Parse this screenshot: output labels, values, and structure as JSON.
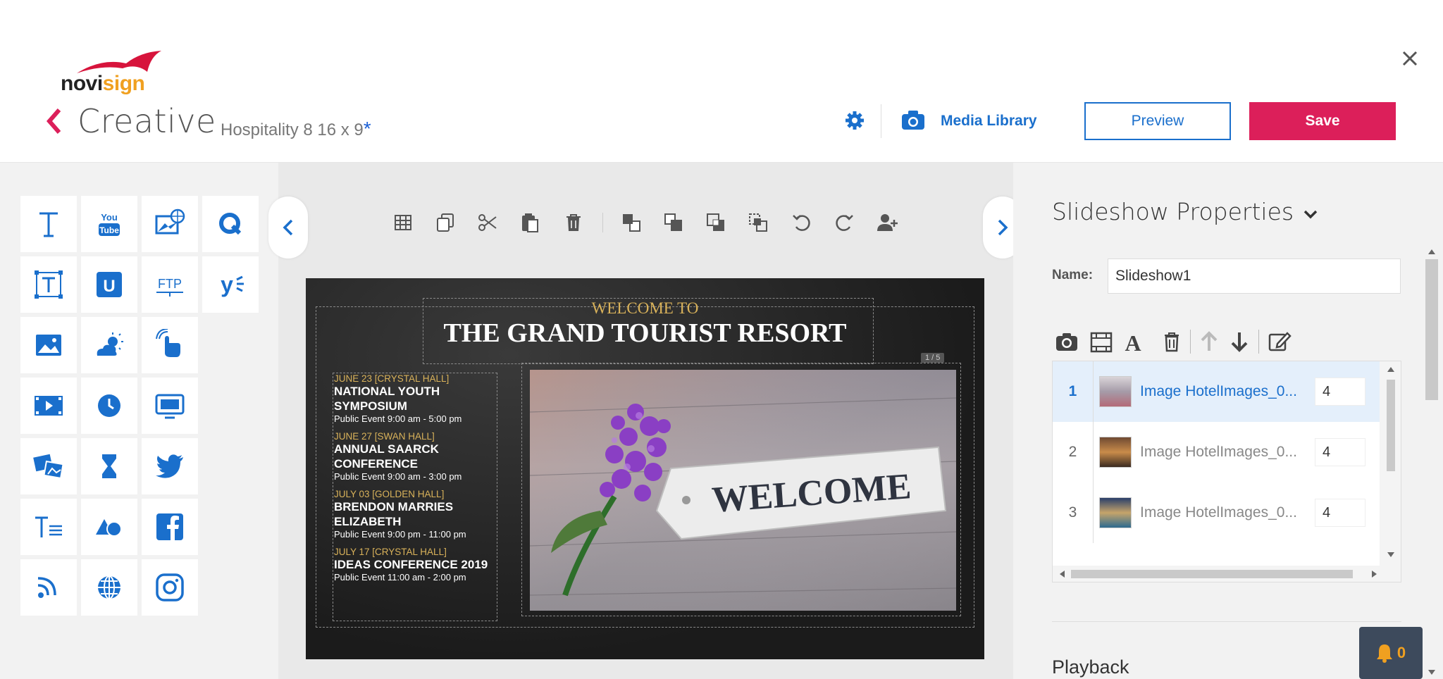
{
  "header": {
    "logo": "novisign",
    "page_title": "Creative",
    "subtitle": "Hospitality 8 16 x 9",
    "unsaved_mark": "*",
    "media_library": "Media Library",
    "preview": "Preview",
    "save": "Save"
  },
  "palette": {
    "tools": [
      "text-icon",
      "youtube-icon",
      "web-image-icon",
      "q-icon",
      "text-box-icon",
      "u-icon",
      "ftp-icon",
      "yext-icon",
      "image-icon",
      "weather-icon",
      "touch-icon",
      "video-icon",
      "clock-icon",
      "screen-icon",
      "gallery-icon",
      "countdown-icon",
      "twitter-icon",
      "ticker-icon",
      "shapes-icon",
      "facebook-icon",
      "rss-icon",
      "globe-icon",
      "instagram-icon"
    ]
  },
  "canvas": {
    "welcome_to": "WELCOME TO",
    "resort_title": "THE GRAND TOURIST RESORT",
    "slide_counter": "1 / 5",
    "photo_text": "WELCOME",
    "events": [
      {
        "date": "JUNE 23 [CRYSTAL HALL]",
        "title": "NATIONAL YOUTH SYMPOSIUM",
        "time": "Public Event 9:00 am - 5:00 pm"
      },
      {
        "date": "JUNE 27 [SWAN HALL]",
        "title": "ANNUAL SAARCK CONFERENCE",
        "time": "Public Event 9:00 am - 3:00 pm"
      },
      {
        "date": "JULY 03 [GOLDEN HALL]",
        "title": "BRENDON MARRIES ELIZABETH",
        "time": "Public Event 9:00 pm - 11:00 pm"
      },
      {
        "date": "JULY 17 [CRYSTAL HALL]",
        "title": "IDEAS CONFERENCE 2019",
        "time": "Public Event 11:00 am - 2:00 pm"
      }
    ]
  },
  "props": {
    "title": "Slideshow Properties",
    "name_label": "Name:",
    "name_value": "Slideshow1",
    "slides": [
      {
        "num": "1",
        "name": "Image HotelImages_0...",
        "duration": "4",
        "active": true
      },
      {
        "num": "2",
        "name": "Image HotelImages_0...",
        "duration": "4",
        "active": false
      },
      {
        "num": "3",
        "name": "Image HotelImages_0...",
        "duration": "4",
        "active": false
      }
    ],
    "playback": "Playback",
    "notifications": "0"
  },
  "colors": {
    "accent_blue": "#1a6fcc",
    "save_red": "#dc1f5a",
    "gold": "#d9b25a"
  }
}
